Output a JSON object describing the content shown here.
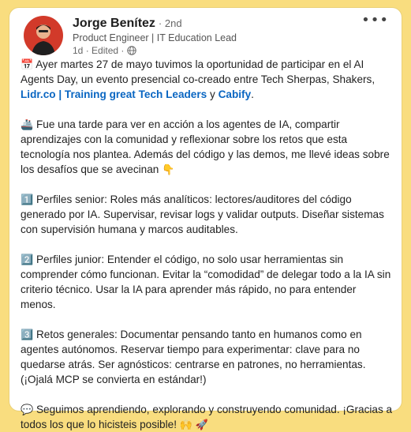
{
  "author": {
    "name": "Jorge Benítez",
    "degree": "· 2nd",
    "headline": "Product Engineer | IT Education Lead",
    "time": "1d",
    "edited": "· Edited ·"
  },
  "icons": {
    "menu": "more-options-icon",
    "visibility": "globe-icon"
  },
  "post": {
    "p1": {
      "emoji": "📅",
      "text_a": " Ayer martes 27 de mayo tuvimos la oportunidad de participar en el AI Agents Day, un evento presencial co-creado entre Tech Sherpas, Shakers, ",
      "link1": "Lidr.co | Training great Tech Leaders",
      "text_b": " y ",
      "link2": "Cabify",
      "text_c": "."
    },
    "p2": {
      "emoji": "🚢",
      "text": " Fue una tarde para ver en acción a los agentes de IA, compartir aprendizajes con la comunidad y reflexionar sobre los retos que esta tecnología nos plantea. Además del código y las demos, me llevé ideas sobre los desafíos que se avecinan ",
      "emoji_end": "👇"
    },
    "p3": {
      "emoji": "1️⃣",
      "text": " Perfiles senior: Roles más analíticos: lectores/auditores del código generado por IA. Supervisar, revisar logs y validar outputs. Diseñar sistemas con supervisión humana y marcos auditables."
    },
    "p4": {
      "emoji": "2️⃣",
      "text": " Perfiles junior: Entender el código, no solo usar herramientas sin comprender cómo funcionan. Evitar la “comodidad” de delegar todo a la IA sin criterio técnico. Usar la IA para aprender más rápido, no para entender menos."
    },
    "p5": {
      "emoji": "3️⃣",
      "text": " Retos generales: Documentar pensando tanto en humanos como en agentes autónomos. Reservar tiempo para experimentar: clave para no quedarse atrás. Ser agnósticos: centrarse en patrones, no herramientas. (¡Ojalá MCP se convierta en estándar!)"
    },
    "p6": {
      "emoji": "💬",
      "text": " Seguimos aprendiendo, explorando y construyendo comunidad. ¡Gracias a todos los que lo hicisteis posible! ",
      "emoji_end": "🙌 🚀"
    }
  },
  "colors": {
    "background": "#f9dd7f",
    "link": "#0a66c2"
  }
}
